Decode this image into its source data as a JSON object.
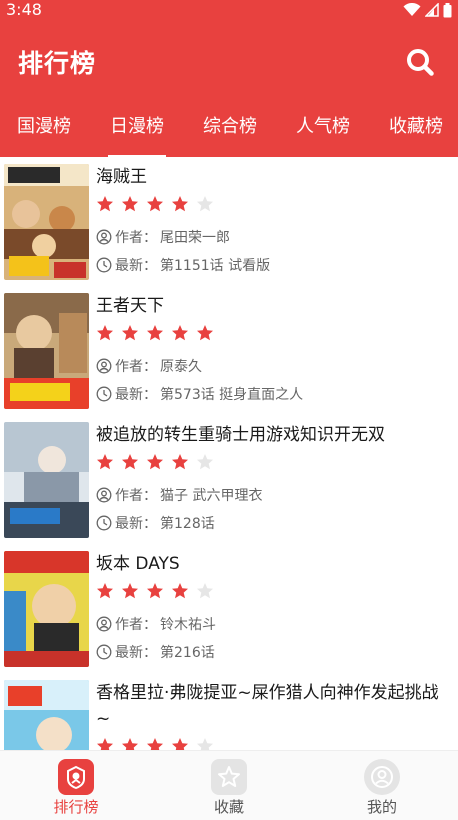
{
  "status": {
    "time": "3:48"
  },
  "header": {
    "title": "排行榜",
    "search_icon": "search-icon"
  },
  "tabs": [
    {
      "label": "国漫榜",
      "active": false
    },
    {
      "label": "日漫榜",
      "active": true
    },
    {
      "label": "综合榜",
      "active": false
    },
    {
      "label": "人气榜",
      "active": false
    },
    {
      "label": "收藏榜",
      "active": false
    }
  ],
  "labels": {
    "author_prefix": "作者：",
    "latest_prefix": "最新："
  },
  "items": [
    {
      "title": "海贼王",
      "rating": 4,
      "author": "尾田荣一郎",
      "latest": "第1151话 试看版"
    },
    {
      "title": "王者天下",
      "rating": 5,
      "author": "原泰久",
      "latest": "第573话 挺身直面之人"
    },
    {
      "title": "被追放的转生重骑士用游戏知识开无双",
      "rating": 4,
      "author": "猫子 武六甲理衣",
      "latest": "第128话"
    },
    {
      "title": "坂本 DAYS",
      "rating": 4,
      "author": "铃木祐斗",
      "latest": "第216话"
    },
    {
      "title": "香格里拉·弗陇提亚~屎作猎人向神作发起挑战~",
      "rating": 4,
      "author": "",
      "latest": ""
    }
  ],
  "colors": {
    "accent": "#e8413f",
    "star_empty": "#e6e6e6"
  },
  "bottom_nav": [
    {
      "label": "排行榜",
      "icon": "ranking-icon",
      "active": true
    },
    {
      "label": "收藏",
      "icon": "star-icon",
      "active": false
    },
    {
      "label": "我的",
      "icon": "user-icon",
      "active": false
    }
  ]
}
